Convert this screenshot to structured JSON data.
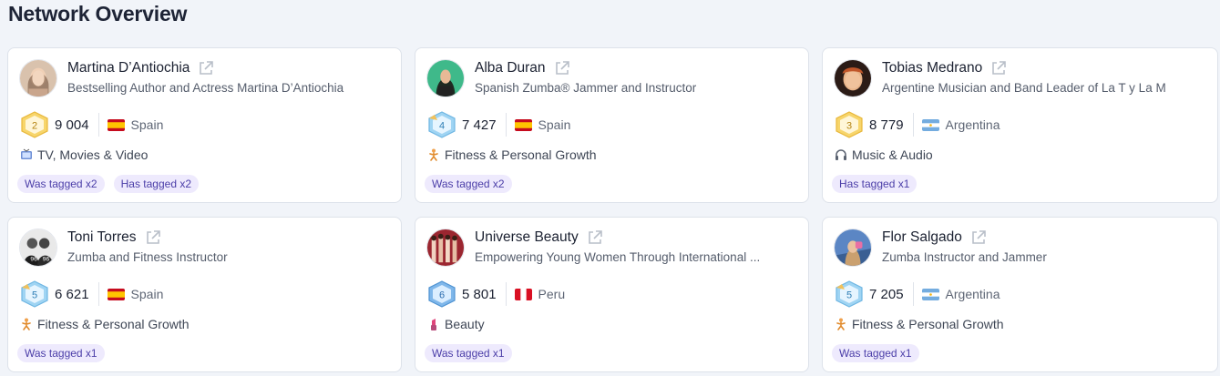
{
  "page": {
    "title": "Network Overview"
  },
  "cards": [
    {
      "name": "Martina D’Antiochia",
      "description": "Bestselling Author and Actress Martina D’Antiochia",
      "level": "2",
      "followers": "9 004",
      "country": "Spain",
      "category_icon": "tv-icon",
      "category": "TV, Movies & Video",
      "tags": [
        "Was tagged x2",
        "Has tagged x2"
      ]
    },
    {
      "name": "Alba Duran",
      "description": "Spanish Zumba® Jammer and Instructor",
      "level": "4",
      "followers": "7 427",
      "country": "Spain",
      "category_icon": "fitness-icon",
      "category": "Fitness & Personal Growth",
      "tags": [
        "Was tagged x2"
      ]
    },
    {
      "name": "Tobias Medrano",
      "description": "Argentine Musician and Band Leader of La T y La M",
      "level": "3",
      "followers": "8 779",
      "country": "Argentina",
      "category_icon": "headphones-icon",
      "category": "Music & Audio",
      "tags": [
        "Has tagged x1"
      ]
    },
    {
      "name": "Toni Torres",
      "description": "Zumba and Fitness Instructor",
      "level": "5",
      "followers": "6 621",
      "country": "Spain",
      "category_icon": "fitness-icon",
      "category": "Fitness & Personal Growth",
      "tags": [
        "Was tagged x1"
      ]
    },
    {
      "name": "Universe Beauty",
      "description": "Empowering Young Women Through International ...",
      "level": "6",
      "followers": "5 801",
      "country": "Peru",
      "category_icon": "lipstick-icon",
      "category": "Beauty",
      "tags": [
        "Was tagged x1"
      ]
    },
    {
      "name": "Flor Salgado",
      "description": "Zumba Instructor and Jammer",
      "level": "5",
      "followers": "7 205",
      "country": "Argentina",
      "category_icon": "fitness-icon",
      "category": "Fitness & Personal Growth",
      "tags": [
        "Was tagged x1"
      ]
    }
  ],
  "colors": {
    "background": "#f1f4f9",
    "tag_bg": "#eeeafd",
    "tag_text": "#4b3ea8",
    "badge_gold": "#f4c542",
    "badge_blue": "#7fc6ee"
  }
}
